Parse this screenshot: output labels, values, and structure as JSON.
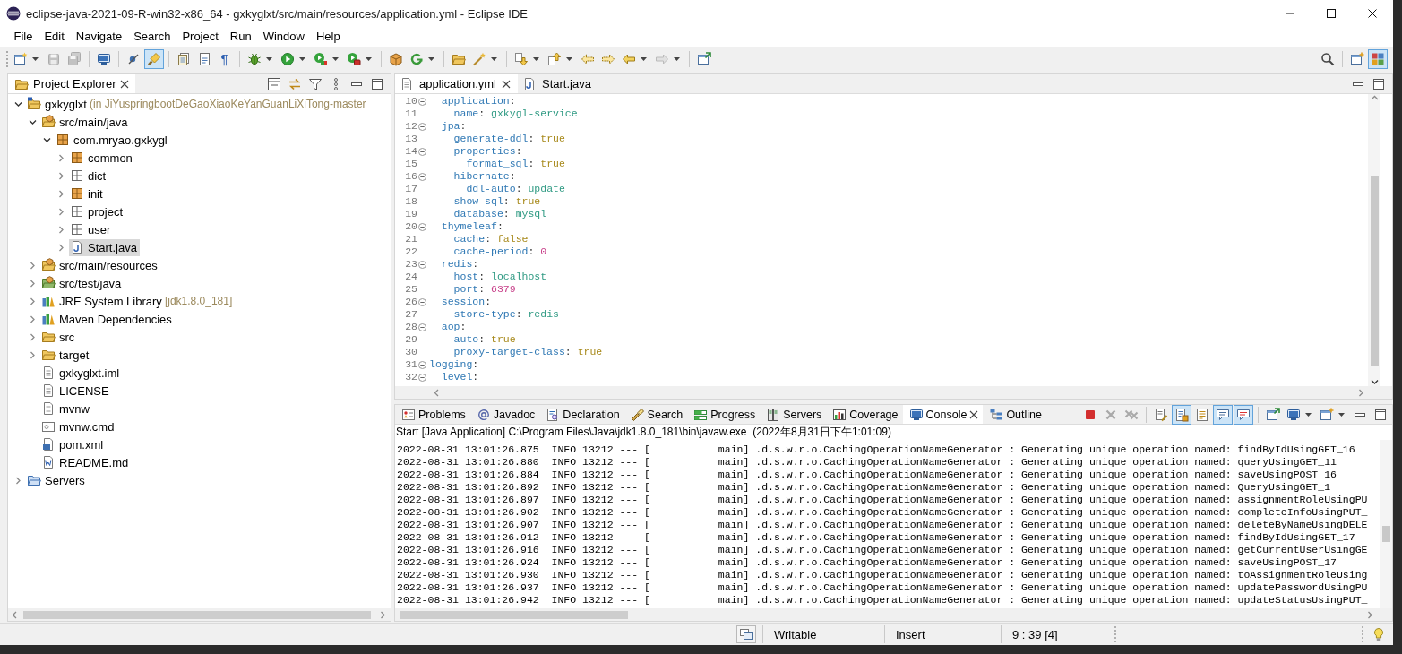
{
  "window": {
    "title": "eclipse-java-2021-09-R-win32-x86_64 - gxkyglxt/src/main/resources/application.yml - Eclipse IDE"
  },
  "menu": [
    "File",
    "Edit",
    "Navigate",
    "Search",
    "Project",
    "Run",
    "Window",
    "Help"
  ],
  "toolbar": {
    "left": [
      [
        {
          "kind": "new",
          "dropdown": true,
          "disabled": false,
          "pressed": false
        },
        {
          "kind": "save",
          "dropdown": false,
          "disabled": true,
          "pressed": false
        },
        {
          "kind": "save-all",
          "dropdown": false,
          "disabled": true,
          "pressed": false
        }
      ],
      [
        {
          "kind": "terminal",
          "dropdown": false,
          "disabled": false,
          "pressed": false
        }
      ],
      [
        {
          "kind": "skip",
          "dropdown": false,
          "disabled": false,
          "pressed": false
        },
        {
          "kind": "brush",
          "dropdown": false,
          "disabled": false,
          "pressed": true
        }
      ],
      [
        {
          "kind": "documents",
          "dropdown": false,
          "disabled": false,
          "pressed": false
        },
        {
          "kind": "document",
          "dropdown": false,
          "disabled": false,
          "pressed": false
        },
        {
          "kind": "glyph",
          "text": "¶",
          "dropdown": false,
          "disabled": false,
          "pressed": false
        }
      ],
      [
        {
          "kind": "debug",
          "dropdown": true,
          "disabled": false,
          "pressed": false
        },
        {
          "kind": "run",
          "dropdown": true,
          "disabled": false,
          "pressed": false
        },
        {
          "kind": "coverage",
          "dropdown": true,
          "disabled": false,
          "pressed": false
        },
        {
          "kind": "external",
          "dropdown": true,
          "disabled": false,
          "pressed": false
        }
      ],
      [
        {
          "kind": "box",
          "dropdown": false,
          "disabled": false,
          "pressed": false
        },
        {
          "kind": "refresh",
          "dropdown": true,
          "disabled": false,
          "pressed": false
        }
      ],
      [
        {
          "kind": "open-folder",
          "dropdown": false,
          "disabled": false,
          "pressed": false
        },
        {
          "kind": "wand",
          "dropdown": true,
          "disabled": false,
          "pressed": false
        }
      ],
      [
        {
          "kind": "next-annotation",
          "dropdown": true,
          "disabled": false,
          "pressed": false
        },
        {
          "kind": "prev-annotation",
          "dropdown": true,
          "disabled": false,
          "pressed": false
        },
        {
          "kind": "last-edit",
          "dropdown": false,
          "disabled": false,
          "pressed": false
        },
        {
          "kind": "next-edit",
          "dropdown": false,
          "disabled": false,
          "pressed": false
        },
        {
          "kind": "back",
          "dropdown": true,
          "disabled": false,
          "pressed": false
        },
        {
          "kind": "forward",
          "dropdown": true,
          "disabled": true,
          "pressed": false
        }
      ],
      [
        {
          "kind": "window-arrow",
          "dropdown": false,
          "disabled": false,
          "pressed": false
        }
      ]
    ],
    "right": [
      [
        {
          "kind": "search",
          "dropdown": false,
          "disabled": false,
          "pressed": false
        }
      ],
      [
        {
          "kind": "window-plus",
          "dropdown": false,
          "disabled": false,
          "pressed": false
        },
        {
          "kind": "tiles",
          "dropdown": false,
          "disabled": false,
          "pressed": true
        }
      ]
    ]
  },
  "project_explorer": {
    "tabs": [
      {
        "label": "Project Explorer",
        "selected": true
      }
    ],
    "tree": [
      {
        "label": "gxkyglxt",
        "decoration": "(in JiYuspringbootDeGaoXiaoKeYanGuanLiXiTong-master",
        "kind": "project",
        "expanded": true,
        "selected": false,
        "children": [
          {
            "label": "src/main/java",
            "kind": "source-folder",
            "expanded": true,
            "selected": false,
            "children": [
              {
                "label": "com.mryao.gxkygl",
                "kind": "package",
                "expanded": true,
                "selected": false,
                "children": [
                  {
                    "label": "common",
                    "kind": "package",
                    "expanded": false,
                    "selected": false
                  },
                  {
                    "label": "dict",
                    "kind": "empty-package",
                    "expanded": false,
                    "selected": false
                  },
                  {
                    "label": "init",
                    "kind": "package",
                    "expanded": false,
                    "selected": false
                  },
                  {
                    "label": "project",
                    "kind": "empty-package",
                    "expanded": false,
                    "selected": false
                  },
                  {
                    "label": "user",
                    "kind": "empty-package",
                    "expanded": false,
                    "selected": false
                  },
                  {
                    "label": "Start.java",
                    "kind": "java-file",
                    "expanded": false,
                    "selected": true
                  }
                ]
              }
            ]
          },
          {
            "label": "src/main/resources",
            "kind": "source-folder",
            "expanded": false,
            "selected": false
          },
          {
            "label": "src/test/java",
            "kind": "test-source-folder",
            "expanded": false,
            "selected": false
          },
          {
            "label": "JRE System Library",
            "decoration": "[jdk1.8.0_181]",
            "kind": "library",
            "expanded": false,
            "selected": false
          },
          {
            "label": "Maven Dependencies",
            "kind": "library",
            "expanded": false,
            "selected": false
          },
          {
            "label": "src",
            "kind": "folder",
            "expanded": false,
            "selected": false
          },
          {
            "label": "target",
            "kind": "folder",
            "expanded": false,
            "selected": false
          },
          {
            "label": "gxkyglxt.iml",
            "kind": "text-file",
            "selected": false
          },
          {
            "label": "LICENSE",
            "kind": "text-file",
            "selected": false
          },
          {
            "label": "mvnw",
            "kind": "text-file",
            "selected": false
          },
          {
            "label": "mvnw.cmd",
            "kind": "script-file",
            "selected": false
          },
          {
            "label": "pom.xml",
            "kind": "xml-file",
            "selected": false
          },
          {
            "label": "README.md",
            "kind": "word-file",
            "selected": false
          }
        ]
      },
      {
        "label": "Servers",
        "kind": "server-folder",
        "expanded": false,
        "selected": false
      }
    ]
  },
  "editor": {
    "tabs": [
      {
        "label": "application.yml",
        "kind": "text-file",
        "selected": true
      },
      {
        "label": "Start.java",
        "kind": "java-file",
        "selected": false
      }
    ],
    "lines": [
      {
        "number": "10",
        "fold": true,
        "tokens": [
          {
            "text": "  application",
            "kind": "key"
          },
          {
            "text": ":",
            "kind": "punct"
          }
        ]
      },
      {
        "number": "11",
        "fold": false,
        "tokens": [
          {
            "text": "    name",
            "kind": "key"
          },
          {
            "text": ": ",
            "kind": "punct"
          },
          {
            "text": "gxkygl-service",
            "kind": "string"
          }
        ]
      },
      {
        "number": "12",
        "fold": true,
        "tokens": [
          {
            "text": "  jpa",
            "kind": "key"
          },
          {
            "text": ":",
            "kind": "punct"
          }
        ]
      },
      {
        "number": "13",
        "fold": false,
        "tokens": [
          {
            "text": "    generate-ddl",
            "kind": "key"
          },
          {
            "text": ": ",
            "kind": "punct"
          },
          {
            "text": "true",
            "kind": "boolean"
          }
        ]
      },
      {
        "number": "14",
        "fold": true,
        "tokens": [
          {
            "text": "    properties",
            "kind": "key"
          },
          {
            "text": ":",
            "kind": "punct"
          }
        ]
      },
      {
        "number": "15",
        "fold": false,
        "tokens": [
          {
            "text": "      format_sql",
            "kind": "key"
          },
          {
            "text": ": ",
            "kind": "punct"
          },
          {
            "text": "true",
            "kind": "boolean"
          }
        ]
      },
      {
        "number": "16",
        "fold": true,
        "tokens": [
          {
            "text": "    hibernate",
            "kind": "key"
          },
          {
            "text": ":",
            "kind": "punct"
          }
        ]
      },
      {
        "number": "17",
        "fold": false,
        "tokens": [
          {
            "text": "      ddl-auto",
            "kind": "key"
          },
          {
            "text": ": ",
            "kind": "punct"
          },
          {
            "text": "update",
            "kind": "string"
          }
        ]
      },
      {
        "number": "18",
        "fold": false,
        "tokens": [
          {
            "text": "    show-sql",
            "kind": "key"
          },
          {
            "text": ": ",
            "kind": "punct"
          },
          {
            "text": "true",
            "kind": "boolean"
          }
        ]
      },
      {
        "number": "19",
        "fold": false,
        "tokens": [
          {
            "text": "    database",
            "kind": "key"
          },
          {
            "text": ": ",
            "kind": "punct"
          },
          {
            "text": "mysql",
            "kind": "string"
          }
        ]
      },
      {
        "number": "20",
        "fold": true,
        "tokens": [
          {
            "text": "  thymeleaf",
            "kind": "key"
          },
          {
            "text": ":",
            "kind": "punct"
          }
        ]
      },
      {
        "number": "21",
        "fold": false,
        "tokens": [
          {
            "text": "    cache",
            "kind": "key"
          },
          {
            "text": ": ",
            "kind": "punct"
          },
          {
            "text": "false",
            "kind": "boolean"
          }
        ]
      },
      {
        "number": "22",
        "fold": false,
        "tokens": [
          {
            "text": "    cache-period",
            "kind": "key"
          },
          {
            "text": ": ",
            "kind": "punct"
          },
          {
            "text": "0",
            "kind": "number"
          }
        ]
      },
      {
        "number": "23",
        "fold": true,
        "tokens": [
          {
            "text": "  redis",
            "kind": "key"
          },
          {
            "text": ":",
            "kind": "punct"
          }
        ]
      },
      {
        "number": "24",
        "fold": false,
        "tokens": [
          {
            "text": "    host",
            "kind": "key"
          },
          {
            "text": ": ",
            "kind": "punct"
          },
          {
            "text": "localhost",
            "kind": "string"
          }
        ]
      },
      {
        "number": "25",
        "fold": false,
        "tokens": [
          {
            "text": "    port",
            "kind": "key"
          },
          {
            "text": ": ",
            "kind": "punct"
          },
          {
            "text": "6379",
            "kind": "number"
          }
        ]
      },
      {
        "number": "26",
        "fold": true,
        "tokens": [
          {
            "text": "  session",
            "kind": "key"
          },
          {
            "text": ":",
            "kind": "punct"
          }
        ]
      },
      {
        "number": "27",
        "fold": false,
        "tokens": [
          {
            "text": "    store-type",
            "kind": "key"
          },
          {
            "text": ": ",
            "kind": "punct"
          },
          {
            "text": "redis",
            "kind": "string"
          }
        ]
      },
      {
        "number": "28",
        "fold": true,
        "tokens": [
          {
            "text": "  aop",
            "kind": "key"
          },
          {
            "text": ":",
            "kind": "punct"
          }
        ]
      },
      {
        "number": "29",
        "fold": false,
        "tokens": [
          {
            "text": "    auto",
            "kind": "key"
          },
          {
            "text": ": ",
            "kind": "punct"
          },
          {
            "text": "true",
            "kind": "boolean"
          }
        ]
      },
      {
        "number": "30",
        "fold": false,
        "tokens": [
          {
            "text": "    proxy-target-class",
            "kind": "key"
          },
          {
            "text": ": ",
            "kind": "punct"
          },
          {
            "text": "true",
            "kind": "boolean"
          }
        ]
      },
      {
        "number": "31",
        "fold": true,
        "tokens": [
          {
            "text": "logging",
            "kind": "key"
          },
          {
            "text": ":",
            "kind": "punct"
          }
        ]
      },
      {
        "number": "32",
        "fold": true,
        "tokens": [
          {
            "text": "  level",
            "kind": "key"
          },
          {
            "text": ":",
            "kind": "punct"
          }
        ]
      }
    ]
  },
  "console": {
    "tabs": [
      {
        "label": "Problems",
        "kind": "problems",
        "selected": false
      },
      {
        "label": "Javadoc",
        "kind": "javadoc",
        "selected": false
      },
      {
        "label": "Declaration",
        "kind": "declaration",
        "selected": false
      },
      {
        "label": "Search",
        "kind": "search-view",
        "selected": false
      },
      {
        "label": "Progress",
        "kind": "progress",
        "selected": false
      },
      {
        "label": "Servers",
        "kind": "servers",
        "selected": false
      },
      {
        "label": "Coverage",
        "kind": "coverage-view",
        "selected": false
      },
      {
        "label": "Console",
        "kind": "console",
        "selected": true
      },
      {
        "label": "Outline",
        "kind": "outline",
        "selected": false
      }
    ],
    "toolbar": [
      [
        {
          "kind": "stop",
          "dropdown": false,
          "disabled": false,
          "pressed": false
        },
        {
          "kind": "cross",
          "dropdown": false,
          "disabled": true,
          "pressed": false
        },
        {
          "kind": "double-cross",
          "dropdown": false,
          "disabled": true,
          "pressed": false
        }
      ],
      [
        {
          "kind": "clear",
          "dropdown": false,
          "disabled": false,
          "pressed": false
        },
        {
          "kind": "scroll-lock",
          "dropdown": false,
          "disabled": false,
          "pressed": true
        },
        {
          "kind": "word-wrap",
          "dropdown": false,
          "disabled": false,
          "pressed": false
        },
        {
          "kind": "bubble",
          "dropdown": false,
          "disabled": false,
          "pressed": true
        },
        {
          "kind": "bubble-err",
          "dropdown": false,
          "disabled": false,
          "pressed": true
        }
      ],
      [
        {
          "kind": "window-arrow",
          "dropdown": false,
          "disabled": false,
          "pressed": false
        },
        {
          "kind": "terminal",
          "dropdown": true,
          "disabled": false,
          "pressed": false
        },
        {
          "kind": "window-plus",
          "dropdown": true,
          "disabled": false,
          "pressed": false
        }
      ]
    ],
    "launch": "Start [Java Application] C:\\Program Files\\Java\\jdk1.8.0_181\\bin\\javaw.exe  (2022年8月31日下午1:01:09)",
    "lines": [
      "2022-08-31 13:01:26.875  INFO 13212 --- [           main] .d.s.w.r.o.CachingOperationNameGenerator : Generating unique operation named: findByIdUsingGET_16",
      "2022-08-31 13:01:26.880  INFO 13212 --- [           main] .d.s.w.r.o.CachingOperationNameGenerator : Generating unique operation named: queryUsingGET_11",
      "2022-08-31 13:01:26.884  INFO 13212 --- [           main] .d.s.w.r.o.CachingOperationNameGenerator : Generating unique operation named: saveUsingPOST_16",
      "2022-08-31 13:01:26.892  INFO 13212 --- [           main] .d.s.w.r.o.CachingOperationNameGenerator : Generating unique operation named: QueryUsingGET_1",
      "2022-08-31 13:01:26.897  INFO 13212 --- [           main] .d.s.w.r.o.CachingOperationNameGenerator : Generating unique operation named: assignmentRoleUsingPU",
      "2022-08-31 13:01:26.902  INFO 13212 --- [           main] .d.s.w.r.o.CachingOperationNameGenerator : Generating unique operation named: completeInfoUsingPUT_",
      "2022-08-31 13:01:26.907  INFO 13212 --- [           main] .d.s.w.r.o.CachingOperationNameGenerator : Generating unique operation named: deleteByNameUsingDELE",
      "2022-08-31 13:01:26.912  INFO 13212 --- [           main] .d.s.w.r.o.CachingOperationNameGenerator : Generating unique operation named: findByIdUsingGET_17",
      "2022-08-31 13:01:26.916  INFO 13212 --- [           main] .d.s.w.r.o.CachingOperationNameGenerator : Generating unique operation named: getCurrentUserUsingGE",
      "2022-08-31 13:01:26.924  INFO 13212 --- [           main] .d.s.w.r.o.CachingOperationNameGenerator : Generating unique operation named: saveUsingPOST_17",
      "2022-08-31 13:01:26.930  INFO 13212 --- [           main] .d.s.w.r.o.CachingOperationNameGenerator : Generating unique operation named: toAssignmentRoleUsing",
      "2022-08-31 13:01:26.937  INFO 13212 --- [           main] .d.s.w.r.o.CachingOperationNameGenerator : Generating unique operation named: updatePasswordUsingPU",
      "2022-08-31 13:01:26.942  INFO 13212 --- [           main] .d.s.w.r.o.CachingOperationNameGenerator : Generating unique operation named: updateStatusUsingPUT_"
    ]
  },
  "status_bar": {
    "mode": "Writable",
    "insert_mode": "Insert",
    "position": "9 : 39 [4]"
  }
}
